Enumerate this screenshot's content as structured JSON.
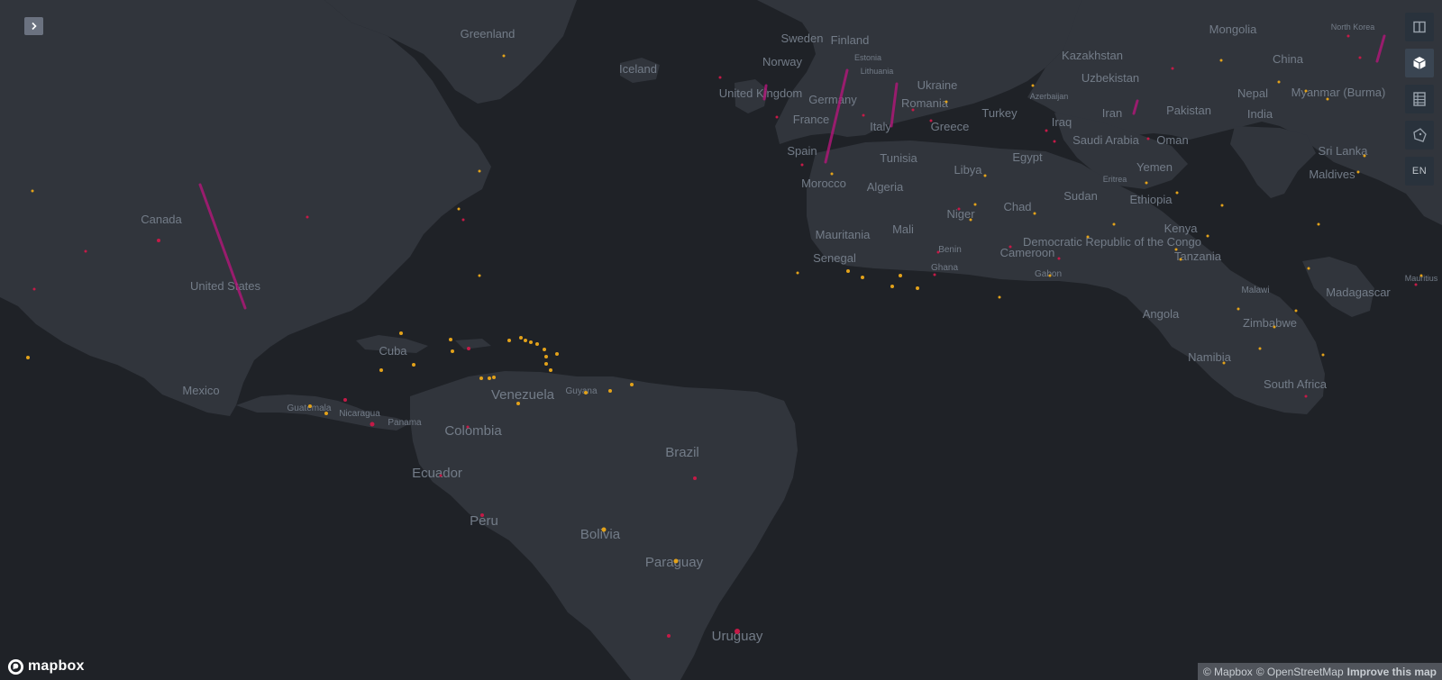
{
  "map": {
    "country_labels": [
      "Greenland",
      "Sweden",
      "Finland",
      "Iceland",
      "Norway",
      "Estonia",
      "Lithuania",
      "Ukraine",
      "United Kingdom",
      "Germany",
      "Romania",
      "France",
      "Italy",
      "Greece",
      "Spain",
      "Tunisia",
      "Morocco",
      "Algeria",
      "Libya",
      "Egypt",
      "Canada",
      "United States",
      "Mali",
      "Mauritania",
      "Niger",
      "Chad",
      "Sudan",
      "Senegal",
      "Benin",
      "Ghana",
      "Cameroon",
      "Gabon",
      "Democratic Republic of the Congo",
      "Ethiopia",
      "Eritrea",
      "Kenya",
      "Tanzania",
      "Kazakhstan",
      "Uzbekistan",
      "Azerbaijan",
      "Turkey",
      "Iraq",
      "Iran",
      "Saudi Arabia",
      "Yemen",
      "Oman",
      "Pakistan",
      "Mongolia",
      "China",
      "North Korea",
      "Nepal",
      "India",
      "Myanmar (Burma)",
      "Sri Lanka",
      "Maldives",
      "Cuba",
      "Mexico",
      "Guatemala",
      "Nicaragua",
      "Panama",
      "Venezuela",
      "Guyana",
      "Colombia",
      "Ecuador",
      "Brazil",
      "Peru",
      "Bolivia",
      "Paraguay",
      "Uruguay",
      "Angola",
      "Malawi",
      "Madagascar",
      "Zimbabwe",
      "Namibia",
      "South Africa",
      "Mauritius"
    ],
    "colors": {
      "land": "#31353c",
      "water": "#1f2227",
      "point_orange": "#e3a21a",
      "point_red": "#c41a47",
      "arc": "#b3167a",
      "label": "#737c88"
    }
  },
  "controls": {
    "sidebar_toggle_icon": "chevron-right-icon",
    "tools": [
      {
        "name": "split-map-icon",
        "active": false
      },
      {
        "name": "3d-box-icon",
        "active": true
      },
      {
        "name": "table-icon",
        "active": false
      },
      {
        "name": "polygon-draw-icon",
        "active": false
      }
    ],
    "language": "EN"
  },
  "branding": {
    "logo_text": "mapbox"
  },
  "attribution": {
    "mapbox": "© Mapbox",
    "osm": "© OpenStreetMap",
    "improve": "Improve this map"
  }
}
